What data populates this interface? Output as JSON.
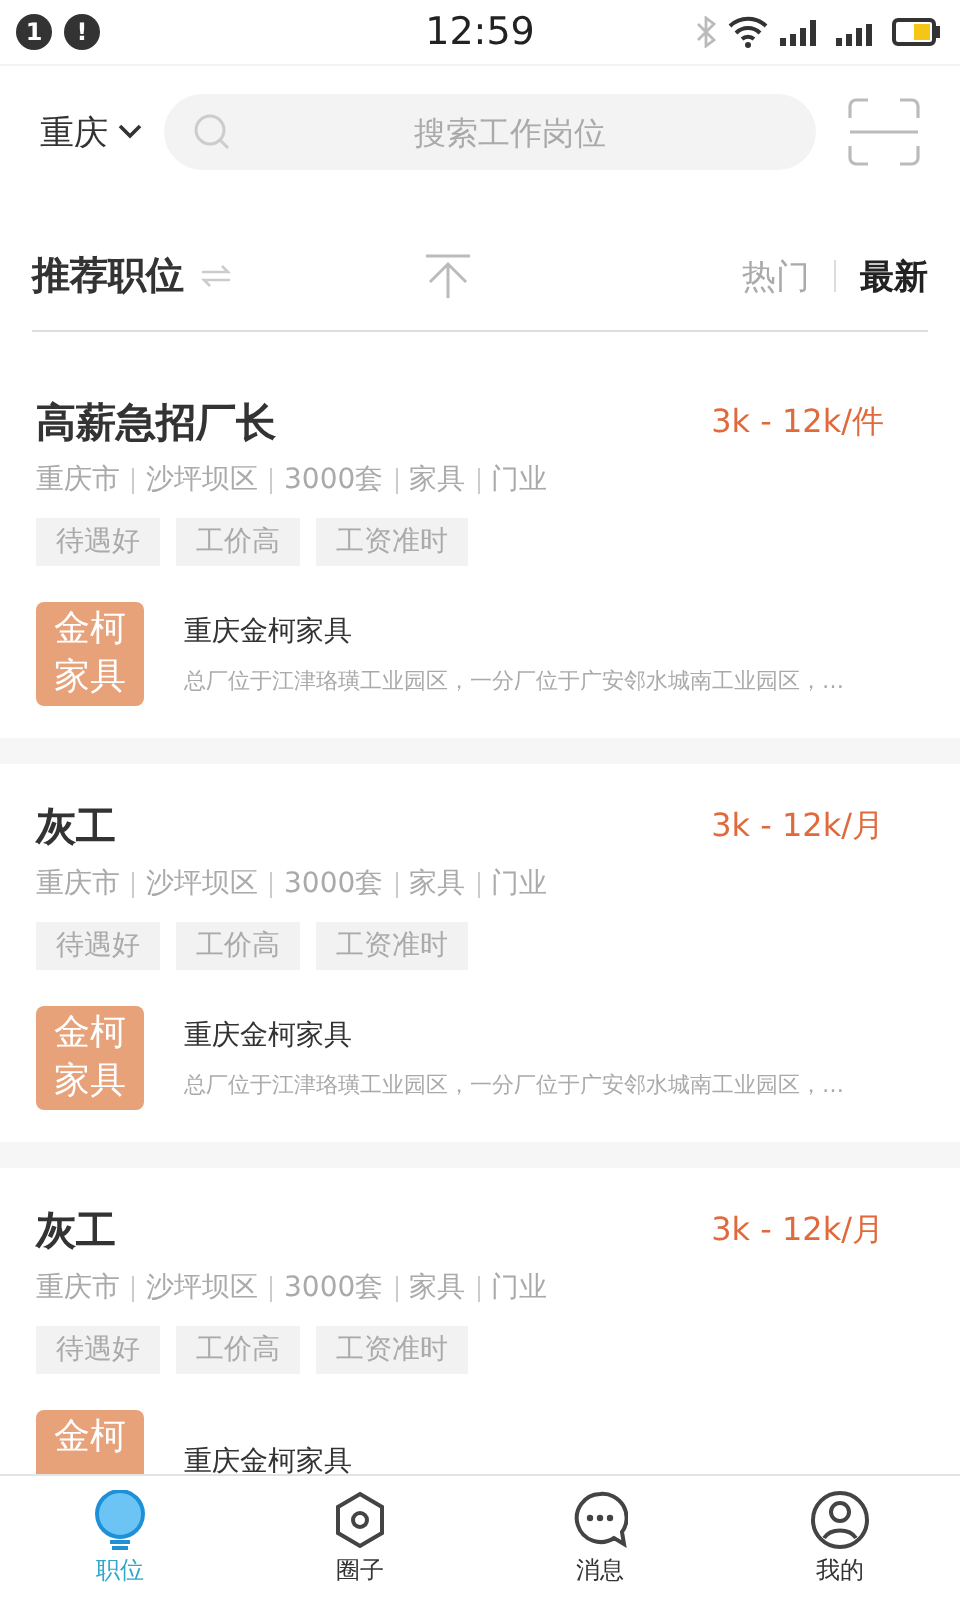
{
  "status_bar": {
    "badges": [
      "1",
      "!"
    ],
    "time": "12:59"
  },
  "header": {
    "city": "重庆",
    "search": {
      "placeholder": "搜索工作岗位"
    }
  },
  "section": {
    "title": "推荐职位",
    "sorts": [
      {
        "label": "热门",
        "selected": false
      },
      {
        "label": "最新",
        "selected": true
      }
    ]
  },
  "jobs": [
    {
      "title": "高薪急招厂长",
      "salary": "3k - 12k/件",
      "meta": [
        "重庆市",
        "沙坪坝区",
        "3000套",
        "家具",
        "门业"
      ],
      "tags": [
        "待遇好",
        "工价高",
        "工资准时"
      ],
      "logo_lines": [
        "金柯",
        "家具"
      ],
      "company": "重庆金柯家具",
      "description": "总厂位于江津珞璜工业园区，一分厂位于广安邻水城南工业园区，…"
    },
    {
      "title": "灰工",
      "salary": "3k - 12k/月",
      "meta": [
        "重庆市",
        "沙坪坝区",
        "3000套",
        "家具",
        "门业"
      ],
      "tags": [
        "待遇好",
        "工价高",
        "工资准时"
      ],
      "logo_lines": [
        "金柯",
        "家具"
      ],
      "company": "重庆金柯家具",
      "description": "总厂位于江津珞璜工业园区，一分厂位于广安邻水城南工业园区，…"
    },
    {
      "title": "灰工",
      "salary": "3k - 12k/月",
      "meta": [
        "重庆市",
        "沙坪坝区",
        "3000套",
        "家具",
        "门业"
      ],
      "tags": [
        "待遇好",
        "工价高",
        "工资准时"
      ],
      "logo_lines": [
        "金柯"
      ],
      "company": "重庆金柯家具"
    }
  ],
  "tab_bar": [
    {
      "kind": "jobs",
      "label": "职位",
      "selected": true
    },
    {
      "kind": "circle",
      "label": "圈子",
      "selected": false
    },
    {
      "kind": "messages",
      "label": "消息",
      "selected": false
    },
    {
      "kind": "profile",
      "label": "我的",
      "selected": false
    }
  ]
}
